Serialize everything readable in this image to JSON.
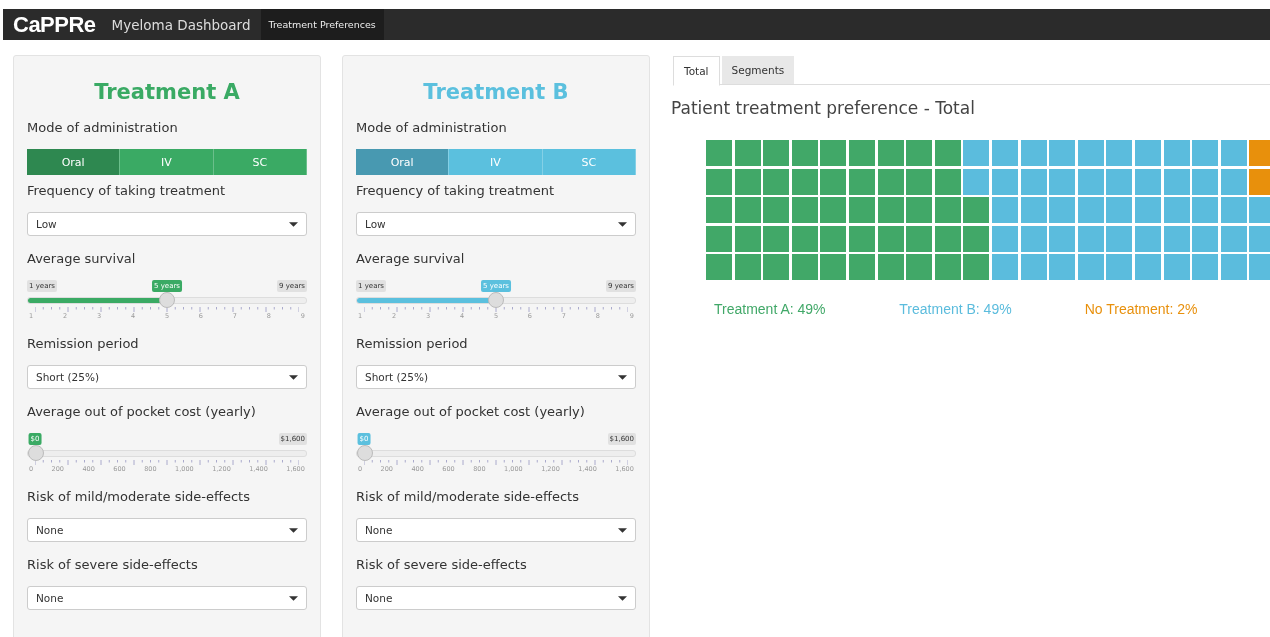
{
  "navbar": {
    "logo": "CaPPRe",
    "title": "Myeloma Dashboard",
    "tabs": [
      {
        "label": "Treatment Preferences",
        "selected": true
      }
    ]
  },
  "panels": [
    {
      "title": "Treatment A",
      "color": "#3aaa64",
      "fields": [
        {
          "kind": "segmented",
          "label": "Mode of administration",
          "options": [
            {
              "label": "Oral",
              "selected": true
            },
            {
              "label": "IV",
              "selected": false
            },
            {
              "label": "SC",
              "selected": false
            }
          ]
        },
        {
          "kind": "select",
          "label": "Frequency of taking treatment",
          "value": "Low"
        },
        {
          "kind": "slider",
          "label": "Average survival",
          "min_label": "1 years",
          "max_label": "9 years",
          "value_label": "5 years",
          "level": 0.5,
          "ticks": [
            "1",
            "2",
            "3",
            "4",
            "5",
            "6",
            "7",
            "8",
            "9"
          ]
        },
        {
          "kind": "select",
          "label": "Remission period",
          "value": "Short (25%)"
        },
        {
          "kind": "slider",
          "label": "Average out of pocket cost (yearly)",
          "max_label": "$1,600",
          "value_label": "$0",
          "level": 0,
          "ticks": [
            "0",
            "200",
            "400",
            "600",
            "800",
            "1,000",
            "1,200",
            "1,400",
            "1,600"
          ]
        },
        {
          "kind": "select",
          "label": "Risk of mild/moderate side-effects",
          "value": "None"
        },
        {
          "kind": "select",
          "label": "Risk of severe side-effects",
          "value": "None"
        }
      ]
    },
    {
      "title": "Treatment B",
      "color": "#5bc0de",
      "fields": [
        {
          "kind": "segmented",
          "label": "Mode of administration",
          "options": [
            {
              "label": "Oral",
              "selected": true
            },
            {
              "label": "IV",
              "selected": false
            },
            {
              "label": "SC",
              "selected": false
            }
          ]
        },
        {
          "kind": "select",
          "label": "Frequency of taking treatment",
          "value": "Low"
        },
        {
          "kind": "slider",
          "label": "Average survival",
          "min_label": "1 years",
          "max_label": "9 years",
          "value_label": "5 years",
          "level": 0.5,
          "ticks": [
            "1",
            "2",
            "3",
            "4",
            "5",
            "6",
            "7",
            "8",
            "9"
          ]
        },
        {
          "kind": "select",
          "label": "Remission period",
          "value": "Short (25%)"
        },
        {
          "kind": "slider",
          "label": "Average out of pocket cost (yearly)",
          "max_label": "$1,600",
          "value_label": "$0",
          "level": 0,
          "ticks": [
            "0",
            "200",
            "400",
            "600",
            "800",
            "1,000",
            "1,200",
            "1,400",
            "1,600"
          ]
        },
        {
          "kind": "select",
          "label": "Risk of mild/moderate side-effects",
          "value": "None"
        },
        {
          "kind": "select",
          "label": "Risk of severe side-effects",
          "value": "None"
        }
      ]
    }
  ],
  "results": {
    "tabs": [
      {
        "label": "Total",
        "selected": true
      },
      {
        "label": "Segments",
        "selected": false
      }
    ],
    "title": "Patient treatment preference - Total",
    "waffle": {
      "rows": [
        [
          {
            "color": "#41a868"
          },
          {
            "color": "#41a868"
          },
          {
            "color": "#41a868"
          },
          {
            "color": "#41a868"
          },
          {
            "color": "#41a868"
          },
          {
            "color": "#41a868"
          },
          {
            "color": "#41a868"
          },
          {
            "color": "#41a868"
          },
          {
            "color": "#41a868"
          },
          {
            "color": "#5bbcdd"
          },
          {
            "color": "#5bbcdd"
          },
          {
            "color": "#5bbcdd"
          },
          {
            "color": "#5bbcdd"
          },
          {
            "color": "#5bbcdd"
          },
          {
            "color": "#5bbcdd"
          },
          {
            "color": "#5bbcdd"
          },
          {
            "color": "#5bbcdd"
          },
          {
            "color": "#5bbcdd"
          },
          {
            "color": "#5bbcdd"
          },
          {
            "color": "#e8900c"
          }
        ],
        [
          {
            "color": "#41a868"
          },
          {
            "color": "#41a868"
          },
          {
            "color": "#41a868"
          },
          {
            "color": "#41a868"
          },
          {
            "color": "#41a868"
          },
          {
            "color": "#41a868"
          },
          {
            "color": "#41a868"
          },
          {
            "color": "#41a868"
          },
          {
            "color": "#41a868"
          },
          {
            "color": "#5bbcdd"
          },
          {
            "color": "#5bbcdd"
          },
          {
            "color": "#5bbcdd"
          },
          {
            "color": "#5bbcdd"
          },
          {
            "color": "#5bbcdd"
          },
          {
            "color": "#5bbcdd"
          },
          {
            "color": "#5bbcdd"
          },
          {
            "color": "#5bbcdd"
          },
          {
            "color": "#5bbcdd"
          },
          {
            "color": "#5bbcdd"
          },
          {
            "color": "#e8900c"
          }
        ],
        [
          {
            "color": "#41a868"
          },
          {
            "color": "#41a868"
          },
          {
            "color": "#41a868"
          },
          {
            "color": "#41a868"
          },
          {
            "color": "#41a868"
          },
          {
            "color": "#41a868"
          },
          {
            "color": "#41a868"
          },
          {
            "color": "#41a868"
          },
          {
            "color": "#41a868"
          },
          {
            "color": "#41a868"
          },
          {
            "color": "#5bbcdd"
          },
          {
            "color": "#5bbcdd"
          },
          {
            "color": "#5bbcdd"
          },
          {
            "color": "#5bbcdd"
          },
          {
            "color": "#5bbcdd"
          },
          {
            "color": "#5bbcdd"
          },
          {
            "color": "#5bbcdd"
          },
          {
            "color": "#5bbcdd"
          },
          {
            "color": "#5bbcdd"
          },
          {
            "color": "#5bbcdd"
          }
        ],
        [
          {
            "color": "#41a868"
          },
          {
            "color": "#41a868"
          },
          {
            "color": "#41a868"
          },
          {
            "color": "#41a868"
          },
          {
            "color": "#41a868"
          },
          {
            "color": "#41a868"
          },
          {
            "color": "#41a868"
          },
          {
            "color": "#41a868"
          },
          {
            "color": "#41a868"
          },
          {
            "color": "#41a868"
          },
          {
            "color": "#5bbcdd"
          },
          {
            "color": "#5bbcdd"
          },
          {
            "color": "#5bbcdd"
          },
          {
            "color": "#5bbcdd"
          },
          {
            "color": "#5bbcdd"
          },
          {
            "color": "#5bbcdd"
          },
          {
            "color": "#5bbcdd"
          },
          {
            "color": "#5bbcdd"
          },
          {
            "color": "#5bbcdd"
          },
          {
            "color": "#5bbcdd"
          }
        ],
        [
          {
            "color": "#41a868"
          },
          {
            "color": "#41a868"
          },
          {
            "color": "#41a868"
          },
          {
            "color": "#41a868"
          },
          {
            "color": "#41a868"
          },
          {
            "color": "#41a868"
          },
          {
            "color": "#41a868"
          },
          {
            "color": "#41a868"
          },
          {
            "color": "#41a868"
          },
          {
            "color": "#41a868"
          },
          {
            "color": "#5bbcdd"
          },
          {
            "color": "#5bbcdd"
          },
          {
            "color": "#5bbcdd"
          },
          {
            "color": "#5bbcdd"
          },
          {
            "color": "#5bbcdd"
          },
          {
            "color": "#5bbcdd"
          },
          {
            "color": "#5bbcdd"
          },
          {
            "color": "#5bbcdd"
          },
          {
            "color": "#5bbcdd"
          },
          {
            "color": "#5bbcdd"
          }
        ]
      ]
    },
    "legend": [
      {
        "label": "Treatment A: 49%",
        "color": "#41a868"
      },
      {
        "label": "Treatment B: 49%",
        "color": "#5bbcdd"
      },
      {
        "label": "No Treatment: 2%",
        "color": "#e8900c"
      }
    ]
  }
}
